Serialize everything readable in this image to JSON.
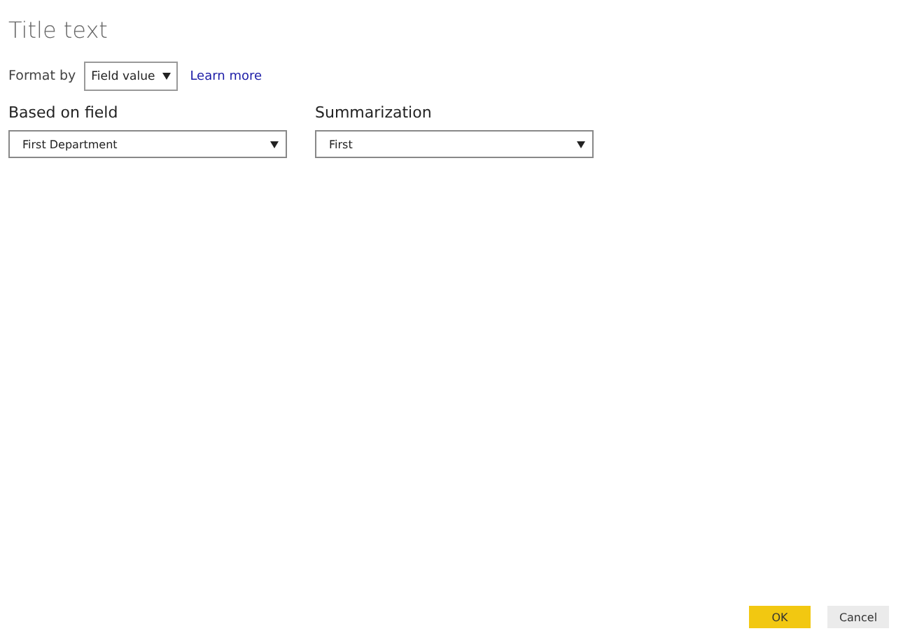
{
  "title": "Title text",
  "format_by": {
    "label": "Format by",
    "value": "Field value",
    "link": "Learn more"
  },
  "fields": [
    {
      "label": "Based on field",
      "value": "First Department"
    },
    {
      "label": "Summarization",
      "value": "First"
    }
  ],
  "buttons": [
    {
      "label": "OK",
      "kind": "primary"
    },
    {
      "label": "Cancel",
      "kind": "secondary"
    }
  ]
}
